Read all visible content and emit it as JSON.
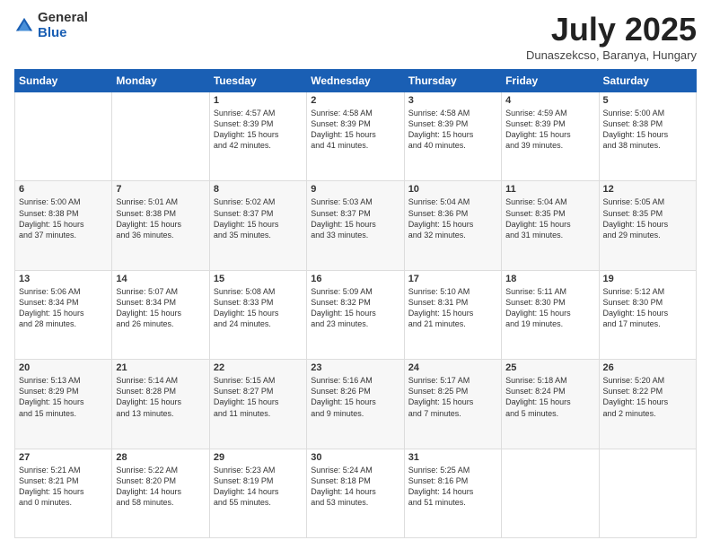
{
  "logo": {
    "general": "General",
    "blue": "Blue"
  },
  "title": {
    "month": "July 2025",
    "location": "Dunaszekcso, Baranya, Hungary"
  },
  "days_of_week": [
    "Sunday",
    "Monday",
    "Tuesday",
    "Wednesday",
    "Thursday",
    "Friday",
    "Saturday"
  ],
  "weeks": [
    [
      {
        "day": "",
        "content": ""
      },
      {
        "day": "",
        "content": ""
      },
      {
        "day": "1",
        "content": "Sunrise: 4:57 AM\nSunset: 8:39 PM\nDaylight: 15 hours\nand 42 minutes."
      },
      {
        "day": "2",
        "content": "Sunrise: 4:58 AM\nSunset: 8:39 PM\nDaylight: 15 hours\nand 41 minutes."
      },
      {
        "day": "3",
        "content": "Sunrise: 4:58 AM\nSunset: 8:39 PM\nDaylight: 15 hours\nand 40 minutes."
      },
      {
        "day": "4",
        "content": "Sunrise: 4:59 AM\nSunset: 8:39 PM\nDaylight: 15 hours\nand 39 minutes."
      },
      {
        "day": "5",
        "content": "Sunrise: 5:00 AM\nSunset: 8:38 PM\nDaylight: 15 hours\nand 38 minutes."
      }
    ],
    [
      {
        "day": "6",
        "content": "Sunrise: 5:00 AM\nSunset: 8:38 PM\nDaylight: 15 hours\nand 37 minutes."
      },
      {
        "day": "7",
        "content": "Sunrise: 5:01 AM\nSunset: 8:38 PM\nDaylight: 15 hours\nand 36 minutes."
      },
      {
        "day": "8",
        "content": "Sunrise: 5:02 AM\nSunset: 8:37 PM\nDaylight: 15 hours\nand 35 minutes."
      },
      {
        "day": "9",
        "content": "Sunrise: 5:03 AM\nSunset: 8:37 PM\nDaylight: 15 hours\nand 33 minutes."
      },
      {
        "day": "10",
        "content": "Sunrise: 5:04 AM\nSunset: 8:36 PM\nDaylight: 15 hours\nand 32 minutes."
      },
      {
        "day": "11",
        "content": "Sunrise: 5:04 AM\nSunset: 8:35 PM\nDaylight: 15 hours\nand 31 minutes."
      },
      {
        "day": "12",
        "content": "Sunrise: 5:05 AM\nSunset: 8:35 PM\nDaylight: 15 hours\nand 29 minutes."
      }
    ],
    [
      {
        "day": "13",
        "content": "Sunrise: 5:06 AM\nSunset: 8:34 PM\nDaylight: 15 hours\nand 28 minutes."
      },
      {
        "day": "14",
        "content": "Sunrise: 5:07 AM\nSunset: 8:34 PM\nDaylight: 15 hours\nand 26 minutes."
      },
      {
        "day": "15",
        "content": "Sunrise: 5:08 AM\nSunset: 8:33 PM\nDaylight: 15 hours\nand 24 minutes."
      },
      {
        "day": "16",
        "content": "Sunrise: 5:09 AM\nSunset: 8:32 PM\nDaylight: 15 hours\nand 23 minutes."
      },
      {
        "day": "17",
        "content": "Sunrise: 5:10 AM\nSunset: 8:31 PM\nDaylight: 15 hours\nand 21 minutes."
      },
      {
        "day": "18",
        "content": "Sunrise: 5:11 AM\nSunset: 8:30 PM\nDaylight: 15 hours\nand 19 minutes."
      },
      {
        "day": "19",
        "content": "Sunrise: 5:12 AM\nSunset: 8:30 PM\nDaylight: 15 hours\nand 17 minutes."
      }
    ],
    [
      {
        "day": "20",
        "content": "Sunrise: 5:13 AM\nSunset: 8:29 PM\nDaylight: 15 hours\nand 15 minutes."
      },
      {
        "day": "21",
        "content": "Sunrise: 5:14 AM\nSunset: 8:28 PM\nDaylight: 15 hours\nand 13 minutes."
      },
      {
        "day": "22",
        "content": "Sunrise: 5:15 AM\nSunset: 8:27 PM\nDaylight: 15 hours\nand 11 minutes."
      },
      {
        "day": "23",
        "content": "Sunrise: 5:16 AM\nSunset: 8:26 PM\nDaylight: 15 hours\nand 9 minutes."
      },
      {
        "day": "24",
        "content": "Sunrise: 5:17 AM\nSunset: 8:25 PM\nDaylight: 15 hours\nand 7 minutes."
      },
      {
        "day": "25",
        "content": "Sunrise: 5:18 AM\nSunset: 8:24 PM\nDaylight: 15 hours\nand 5 minutes."
      },
      {
        "day": "26",
        "content": "Sunrise: 5:20 AM\nSunset: 8:22 PM\nDaylight: 15 hours\nand 2 minutes."
      }
    ],
    [
      {
        "day": "27",
        "content": "Sunrise: 5:21 AM\nSunset: 8:21 PM\nDaylight: 15 hours\nand 0 minutes."
      },
      {
        "day": "28",
        "content": "Sunrise: 5:22 AM\nSunset: 8:20 PM\nDaylight: 14 hours\nand 58 minutes."
      },
      {
        "day": "29",
        "content": "Sunrise: 5:23 AM\nSunset: 8:19 PM\nDaylight: 14 hours\nand 55 minutes."
      },
      {
        "day": "30",
        "content": "Sunrise: 5:24 AM\nSunset: 8:18 PM\nDaylight: 14 hours\nand 53 minutes."
      },
      {
        "day": "31",
        "content": "Sunrise: 5:25 AM\nSunset: 8:16 PM\nDaylight: 14 hours\nand 51 minutes."
      },
      {
        "day": "",
        "content": ""
      },
      {
        "day": "",
        "content": ""
      }
    ]
  ]
}
